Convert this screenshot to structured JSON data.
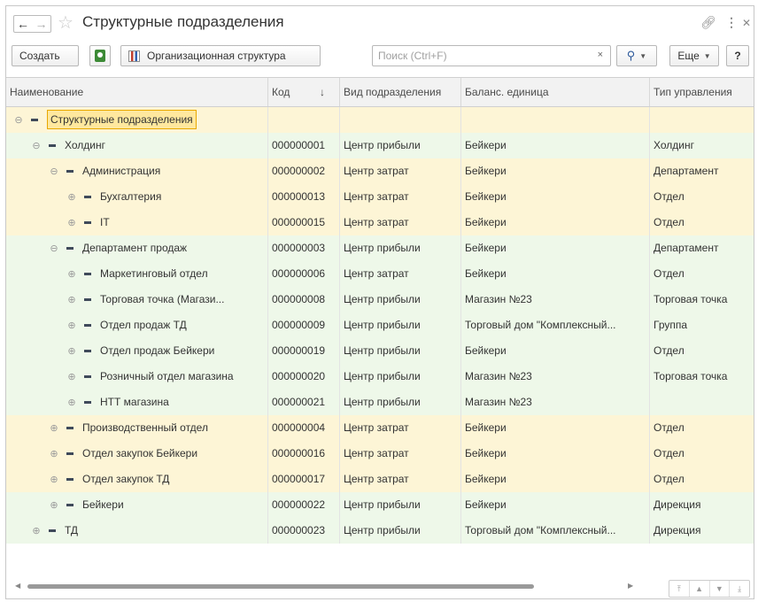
{
  "window": {
    "title": "Структурные подразделения",
    "link_icon": "link-icon",
    "menu_icon": "more-vertical-icon",
    "close_icon": "close-icon"
  },
  "toolbar": {
    "create_label": "Создать",
    "org_structure_label": "Организационная структура",
    "search_placeholder": "Поиск (Ctrl+F)",
    "search_clear": "×",
    "more_label": "Еще",
    "help_label": "?"
  },
  "table": {
    "columns": [
      "Наименование",
      "Код",
      "Вид подразделения",
      "Баланс. единица",
      "Тип управления"
    ],
    "sort_indicator": "↓",
    "rows": [
      {
        "name": "Структурные подразделения",
        "code": "",
        "kind": "",
        "unit": "",
        "type": "",
        "tree": "⊖",
        "level": 0
      },
      {
        "name": "Холдинг",
        "code": "000000001",
        "kind": "Центр прибыли",
        "unit": "Бейкери",
        "type": "Холдинг",
        "tree": "⊖",
        "level": 1
      },
      {
        "name": "Администрация",
        "code": "000000002",
        "kind": "Центр затрат",
        "unit": "Бейкери",
        "type": "Департамент",
        "tree": "⊖",
        "level": 2
      },
      {
        "name": "Бухгалтерия",
        "code": "000000013",
        "kind": "Центр затрат",
        "unit": "Бейкери",
        "type": "Отдел",
        "tree": "⊕",
        "level": 3
      },
      {
        "name": "IT",
        "code": "000000015",
        "kind": "Центр затрат",
        "unit": "Бейкери",
        "type": "Отдел",
        "tree": "⊕",
        "level": 3
      },
      {
        "name": "Департамент продаж",
        "code": "000000003",
        "kind": "Центр прибыли",
        "unit": "Бейкери",
        "type": "Департамент",
        "tree": "⊖",
        "level": 2
      },
      {
        "name": "Маркетинговый отдел",
        "code": "000000006",
        "kind": "Центр затрат",
        "unit": "Бейкери",
        "type": "Отдел",
        "tree": "⊕",
        "level": 3
      },
      {
        "name": "Торговая точка (Магази...",
        "code": "000000008",
        "kind": "Центр прибыли",
        "unit": "Магазин №23",
        "type": "Торговая точка",
        "tree": "⊕",
        "level": 3
      },
      {
        "name": "Отдел продаж ТД",
        "code": "000000009",
        "kind": "Центр прибыли",
        "unit": "Торговый дом \"Комплексный...",
        "type": "Группа",
        "tree": "⊕",
        "level": 3
      },
      {
        "name": "Отдел продаж Бейкери",
        "code": "000000019",
        "kind": "Центр прибыли",
        "unit": "Бейкери",
        "type": "Отдел",
        "tree": "⊕",
        "level": 3
      },
      {
        "name": "Розничный отдел магазина",
        "code": "000000020",
        "kind": "Центр прибыли",
        "unit": "Магазин №23",
        "type": "Торговая точка",
        "tree": "⊕",
        "level": 3
      },
      {
        "name": "НТТ магазина",
        "code": "000000021",
        "kind": "Центр прибыли",
        "unit": "Магазин №23",
        "type": "",
        "tree": "⊕",
        "level": 3
      },
      {
        "name": "Производственный отдел",
        "code": "000000004",
        "kind": "Центр затрат",
        "unit": "Бейкери",
        "type": "Отдел",
        "tree": "⊕",
        "level": 2
      },
      {
        "name": "Отдел закупок Бейкери",
        "code": "000000016",
        "kind": "Центр затрат",
        "unit": "Бейкери",
        "type": "Отдел",
        "tree": "⊕",
        "level": 2
      },
      {
        "name": "Отдел закупок ТД",
        "code": "000000017",
        "kind": "Центр затрат",
        "unit": "Бейкери",
        "type": "Отдел",
        "tree": "⊕",
        "level": 2
      },
      {
        "name": "Бейкери",
        "code": "000000022",
        "kind": "Центр прибыли",
        "unit": "Бейкери",
        "type": "Дирекция",
        "tree": "⊕",
        "level": 2
      },
      {
        "name": "ТД",
        "code": "000000023",
        "kind": "Центр прибыли",
        "unit": "Торговый дом \"Комплексный...",
        "type": "Дирекция",
        "tree": "⊕",
        "level": 1
      }
    ]
  }
}
